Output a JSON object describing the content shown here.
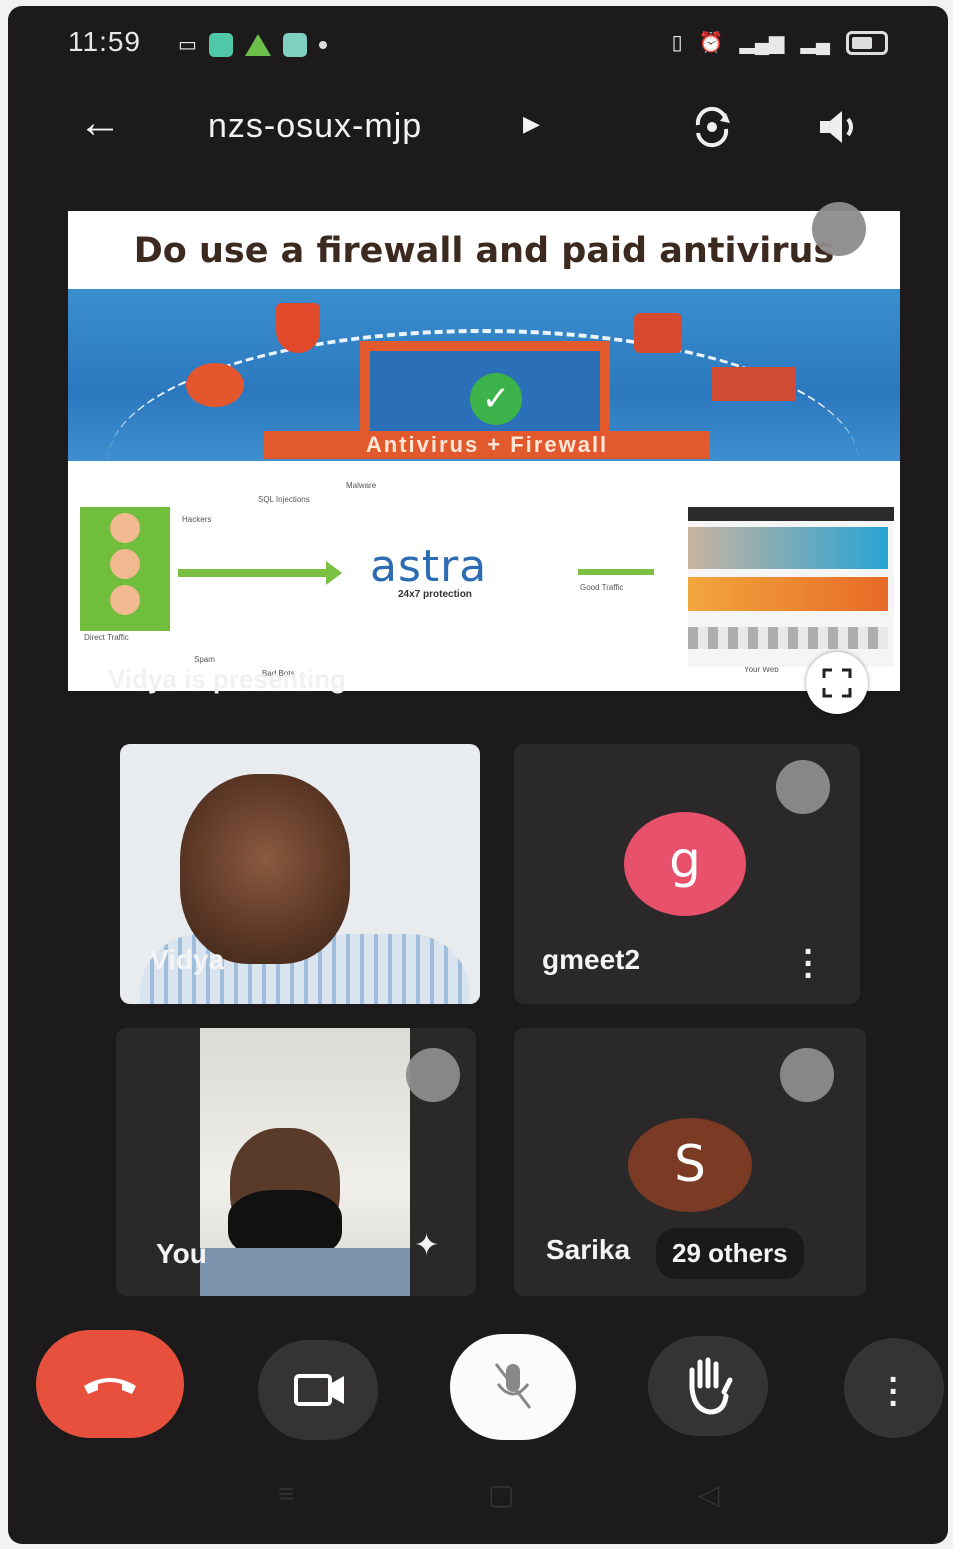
{
  "status_bar": {
    "time": "11:59"
  },
  "app_bar": {
    "meeting_code": "nzs-osux-mjp",
    "icons": [
      "back-arrow-icon",
      "switch-camera-icon",
      "speaker-icon"
    ]
  },
  "presentation": {
    "slide_title": "Do use a firewall and paid antivirus",
    "banner_label": "Antivirus + Firewall",
    "brand": "astra",
    "brand_sub": "24x7 protection",
    "diagram_labels": [
      "Hackers",
      "SQL Injections",
      "Malware",
      "Spam",
      "Bad Bots",
      "Good Traffic",
      "Direct Traffic",
      "Your Web"
    ],
    "presenting_label": "Vidya is presenting"
  },
  "participants": [
    {
      "name": "Vidya"
    },
    {
      "name": "gmeet2",
      "initial": "g",
      "color": "#e8516b"
    },
    {
      "name": "You"
    },
    {
      "name": "Sarika",
      "initial": "S",
      "color": "#7a3a24"
    }
  ],
  "others_label": "29 others",
  "colors": {
    "end_call": "#e8503e",
    "background": "#1c1a1b"
  }
}
